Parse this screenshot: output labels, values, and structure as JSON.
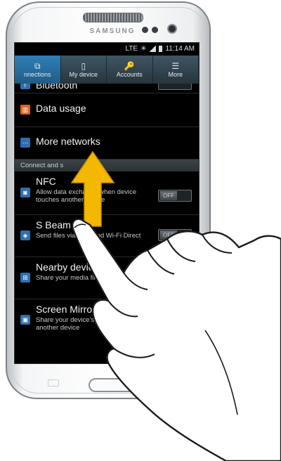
{
  "device": {
    "brand": "SAMSUNG"
  },
  "statusbar": {
    "network": "LTE",
    "time": "11:14 AM"
  },
  "tabs": [
    {
      "label": "nnections",
      "icon": "connections-icon",
      "active": true
    },
    {
      "label": "My device",
      "icon": "device-icon",
      "active": false
    },
    {
      "label": "Accounts",
      "icon": "accounts-icon",
      "active": false
    },
    {
      "label": "More",
      "icon": "more-icon",
      "active": false
    }
  ],
  "list": {
    "bluetooth_label": "Bluetooth",
    "data_usage_label": "Data usage",
    "more_networks_label": "More networks",
    "section_label": "Connect and s",
    "nfc": {
      "title": "NFC",
      "sub": "Allow data exchange when device touches another device",
      "toggle": "OFF"
    },
    "sbeam": {
      "title": "S Beam",
      "sub": "Send files via NFC and Wi-Fi Direct",
      "toggle": "OFF"
    },
    "nearby": {
      "title": "Nearby devices",
      "sub": "Share your media files via DLNA"
    },
    "mirroring": {
      "title": "Screen Mirroring",
      "sub": "Share your device's screen with another device"
    }
  },
  "colors": {
    "arrow": "#f5b800",
    "tab_active": "#2a76ab",
    "data_usage_icon": "#e0621e",
    "networks_icon": "#2f6fb0"
  }
}
